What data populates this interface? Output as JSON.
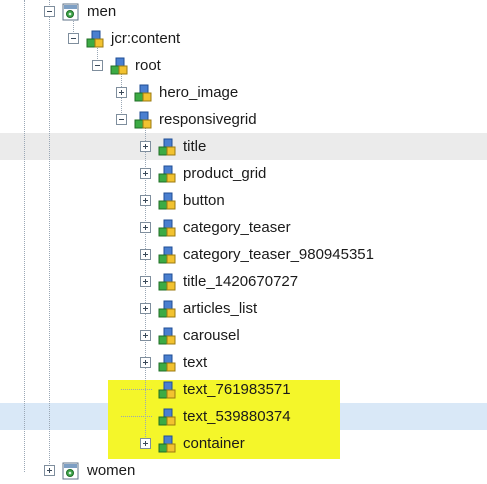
{
  "tree": {
    "nodes": [
      {
        "label": "men",
        "toggle": "minus",
        "icon": "page-icon"
      },
      {
        "label": "jcr:content",
        "toggle": "minus",
        "icon": "node-icon"
      },
      {
        "label": "root",
        "toggle": "minus",
        "icon": "node-icon"
      },
      {
        "label": "hero_image",
        "toggle": "plus",
        "icon": "node-icon"
      },
      {
        "label": "responsivegrid",
        "toggle": "minus",
        "icon": "node-icon"
      },
      {
        "label": "title",
        "toggle": "plus",
        "icon": "node-icon"
      },
      {
        "label": "product_grid",
        "toggle": "plus",
        "icon": "node-icon"
      },
      {
        "label": "button",
        "toggle": "plus",
        "icon": "node-icon"
      },
      {
        "label": "category_teaser",
        "toggle": "plus",
        "icon": "node-icon"
      },
      {
        "label": "category_teaser_980945351",
        "toggle": "plus",
        "icon": "node-icon"
      },
      {
        "label": "title_1420670727",
        "toggle": "plus",
        "icon": "node-icon"
      },
      {
        "label": "articles_list",
        "toggle": "plus",
        "icon": "node-icon"
      },
      {
        "label": "carousel",
        "toggle": "plus",
        "icon": "node-icon"
      },
      {
        "label": "text",
        "toggle": "plus",
        "icon": "node-icon"
      },
      {
        "label": "text_761983571",
        "toggle": "none",
        "icon": "node-icon"
      },
      {
        "label": "text_539880374",
        "toggle": "none",
        "icon": "node-icon"
      },
      {
        "label": "container",
        "toggle": "plus",
        "icon": "node-icon"
      },
      {
        "label": "women",
        "toggle": "plus",
        "icon": "page-icon"
      }
    ],
    "hovered_node": "title",
    "selected_node": "text_539880374",
    "highlighted_nodes": [
      "text_761983571",
      "text_539880374",
      "container"
    ]
  },
  "colors": {
    "highlight": "#f4f62a",
    "selected_row": "#d9e8f7",
    "hover_row": "#ebebeb",
    "connector": "#9aa7b5"
  }
}
